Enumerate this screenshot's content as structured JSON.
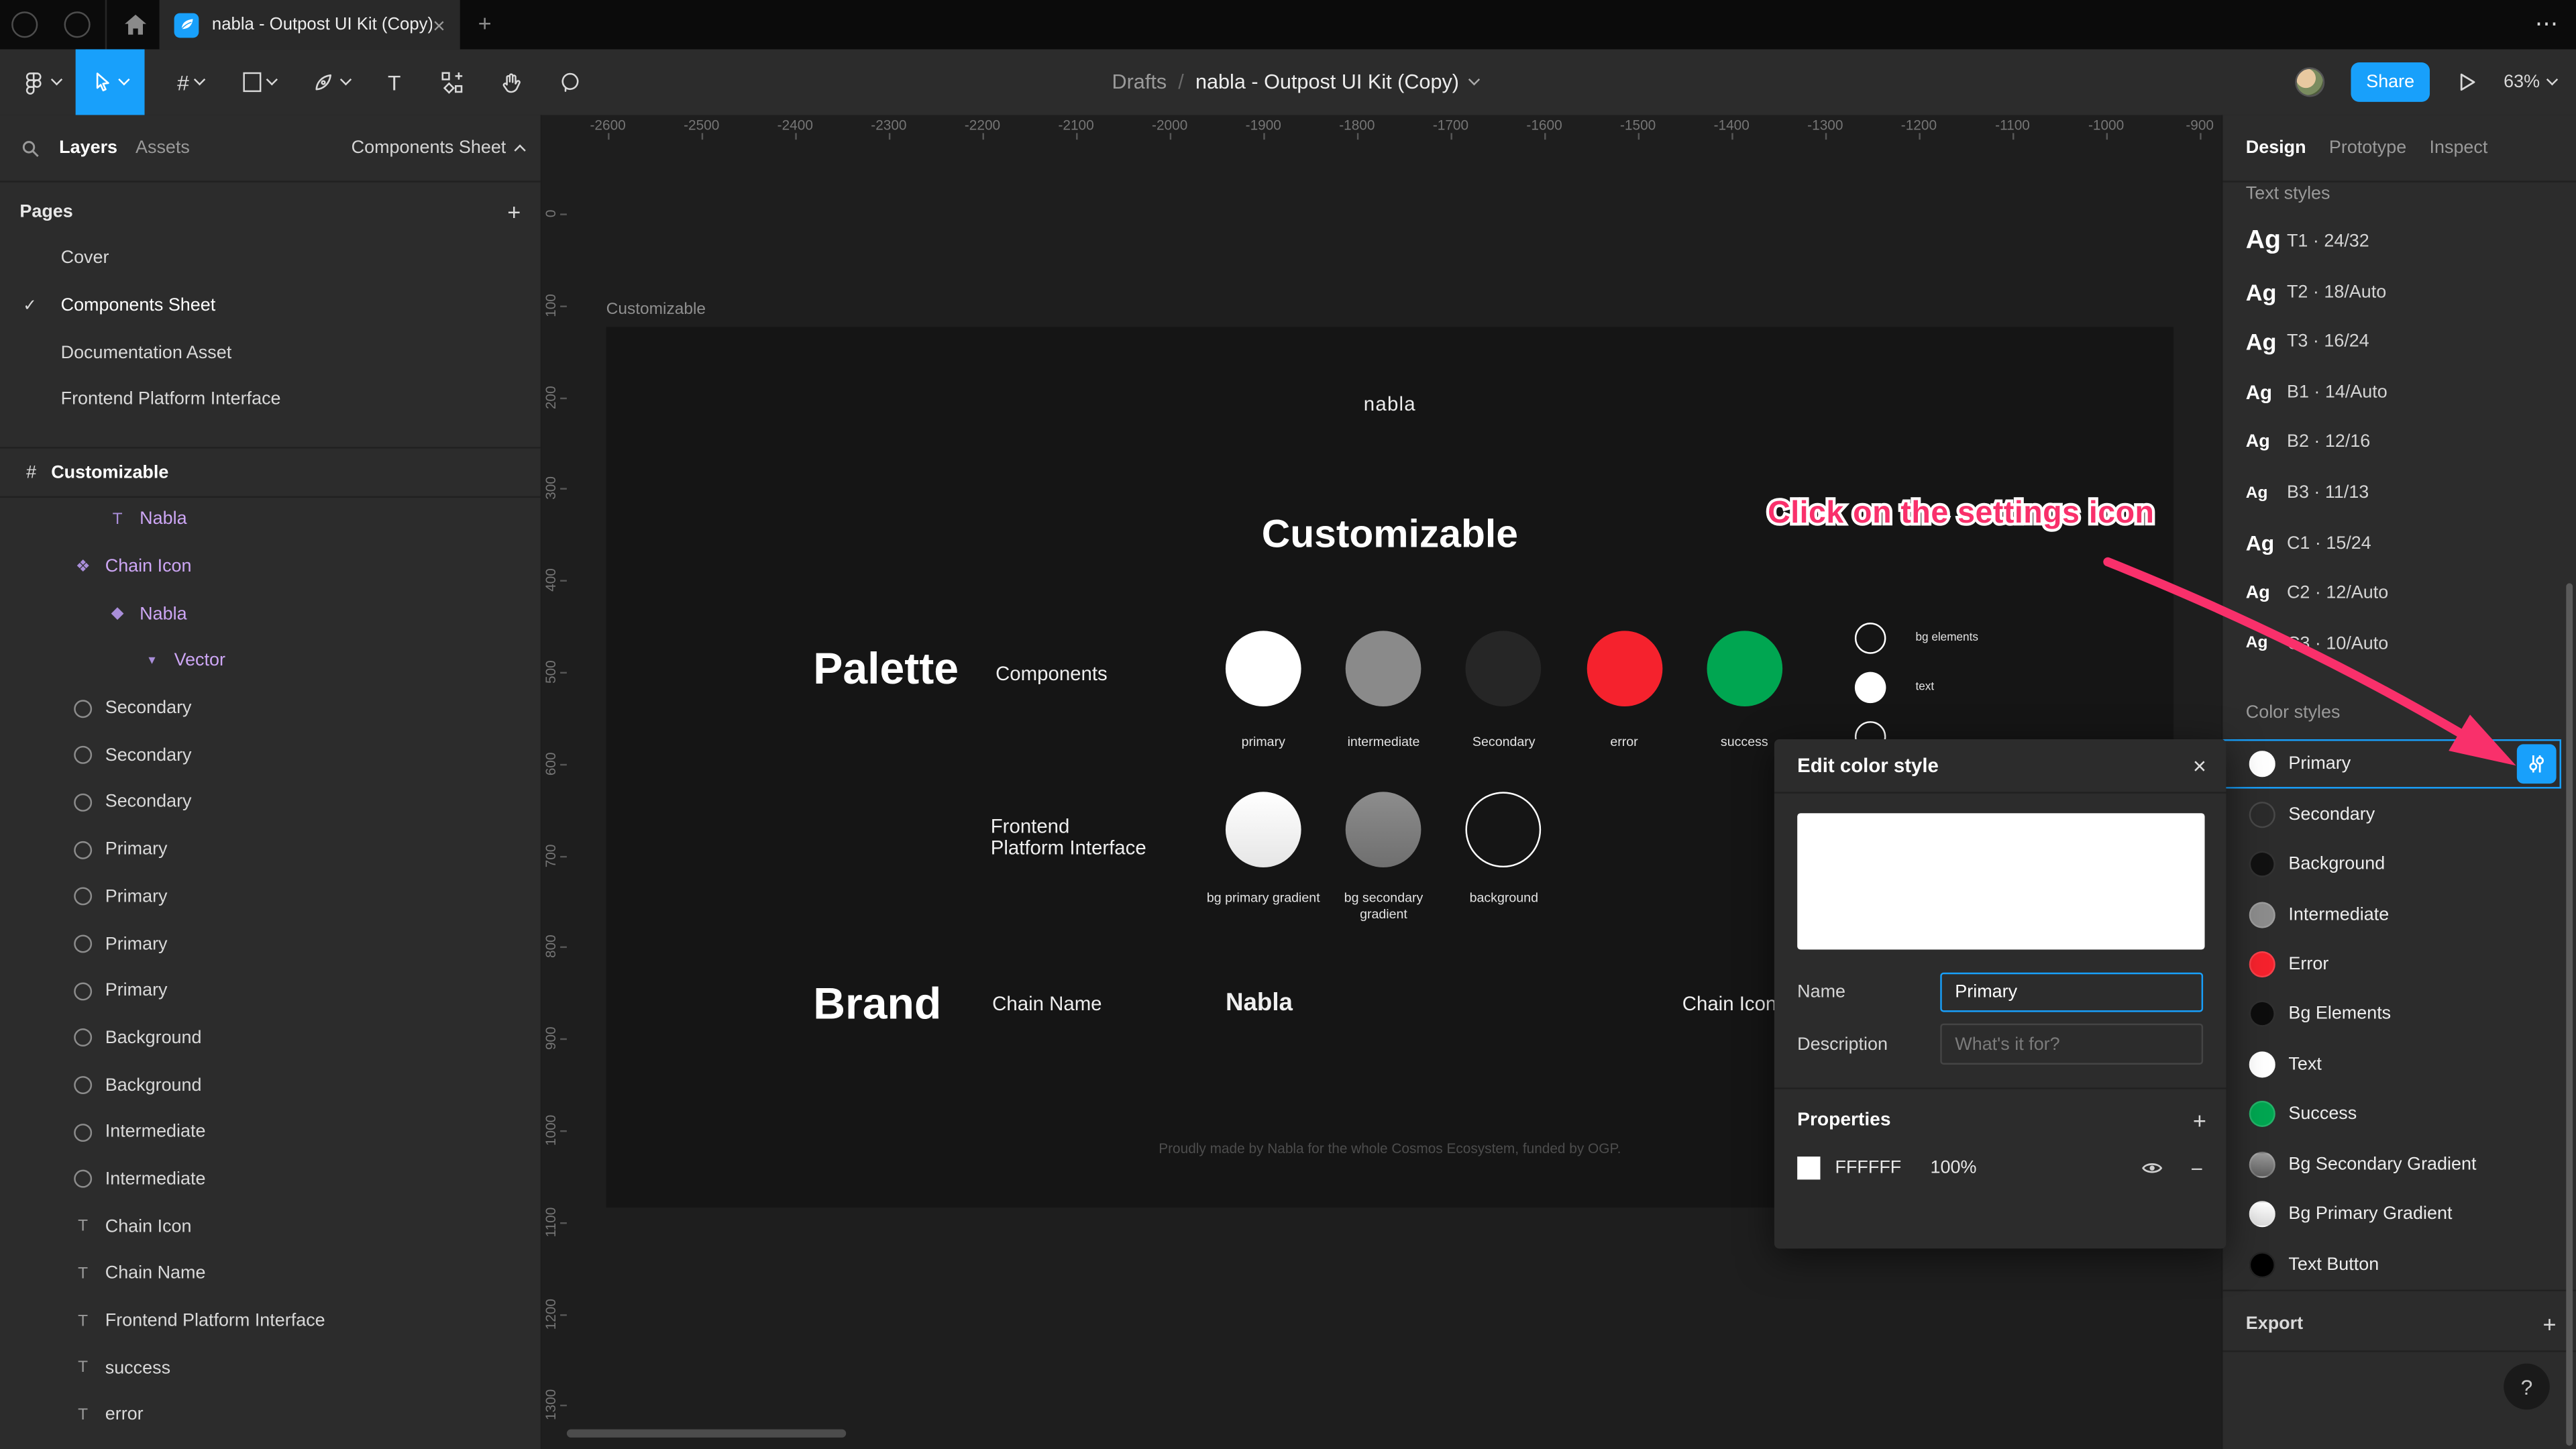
{
  "window": {
    "tab_title": "nabla - Outpost UI Kit (Copy)",
    "close_tab": "×",
    "new_tab": "+",
    "overflow": "⋯"
  },
  "toolbar": {
    "breadcrumb": {
      "root": "Drafts",
      "separator": "/",
      "title": "nabla - Outpost UI Kit (Copy)"
    },
    "share_label": "Share",
    "zoom_level": "63%"
  },
  "left_panel": {
    "tab_layers": "Layers",
    "tab_assets": "Assets",
    "page_selector": "Components Sheet",
    "pages_header": "Pages",
    "add_page": "+",
    "pages": [
      {
        "label": "Cover",
        "checked": ""
      },
      {
        "label": "Components Sheet",
        "checked": "✓"
      },
      {
        "label": "Documentation Asset",
        "checked": ""
      },
      {
        "label": "Frontend Platform Interface",
        "checked": ""
      }
    ],
    "section": {
      "icon": "#",
      "label": "Customizable"
    },
    "layers": [
      {
        "kind": "text",
        "label": "Nabla",
        "purple": true,
        "indent": 2
      },
      {
        "kind": "component",
        "label": "Chain Icon",
        "purple": true,
        "indent": 1
      },
      {
        "kind": "instance",
        "label": "Nabla",
        "purple": true,
        "indent": 2
      },
      {
        "kind": "vector",
        "label": "Vector",
        "purple": true,
        "indent": 3
      },
      {
        "kind": "ellipse",
        "label": "Secondary",
        "purple": false,
        "indent": 1
      },
      {
        "kind": "ellipse",
        "label": "Secondary",
        "purple": false,
        "indent": 1
      },
      {
        "kind": "ellipse",
        "label": "Secondary",
        "purple": false,
        "indent": 1
      },
      {
        "kind": "ellipse",
        "label": "Primary",
        "purple": false,
        "indent": 1
      },
      {
        "kind": "ellipse",
        "label": "Primary",
        "purple": false,
        "indent": 1
      },
      {
        "kind": "ellipse",
        "label": "Primary",
        "purple": false,
        "indent": 1
      },
      {
        "kind": "ellipse",
        "label": "Primary",
        "purple": false,
        "indent": 1
      },
      {
        "kind": "ellipse",
        "label": "Background",
        "purple": false,
        "indent": 1
      },
      {
        "kind": "ellipse",
        "label": "Background",
        "purple": false,
        "indent": 1
      },
      {
        "kind": "ellipse",
        "label": "Intermediate",
        "purple": false,
        "indent": 1
      },
      {
        "kind": "ellipse",
        "label": "Intermediate",
        "purple": false,
        "indent": 1
      },
      {
        "kind": "text",
        "label": "Chain Icon",
        "purple": false,
        "indent": 1
      },
      {
        "kind": "text",
        "label": "Chain Name",
        "purple": false,
        "indent": 1
      },
      {
        "kind": "text",
        "label": "Frontend Platform Interface",
        "purple": false,
        "indent": 1
      },
      {
        "kind": "text",
        "label": "success",
        "purple": false,
        "indent": 1
      },
      {
        "kind": "text",
        "label": "error",
        "purple": false,
        "indent": 1
      }
    ]
  },
  "canvas": {
    "ruler_x": [
      "-2600",
      "-2500",
      "-2400",
      "-2300",
      "-2200",
      "-2100",
      "-2000",
      "-1900",
      "-1800",
      "-1700",
      "-1600",
      "-1500",
      "-1400",
      "-1300",
      "-1200",
      "-1100",
      "-1000",
      "-900"
    ],
    "ruler_y": [
      "0",
      "100",
      "200",
      "300",
      "400",
      "500",
      "600",
      "700",
      "800",
      "900",
      "1000",
      "1100",
      "1200",
      "1300"
    ],
    "frame_label": "Customizable",
    "logo": "nabla",
    "heading": "Customizable",
    "palette": {
      "title": "Palette",
      "subtitle": "Components",
      "swatches": [
        {
          "label": "primary",
          "color": "#ffffff"
        },
        {
          "label": "intermediate",
          "color": "#8a8a8a"
        },
        {
          "label": "Secondary",
          "color": "#262626"
        },
        {
          "label": "error",
          "color": "#f5222d"
        },
        {
          "label": "success",
          "color": "#00a651"
        }
      ],
      "mini": [
        {
          "label": "bg elements",
          "color": "#0d0d0d",
          "outline": true
        },
        {
          "label": "text",
          "color": "#ffffff",
          "outline": false
        },
        {
          "label": "",
          "color": "#0d0d0d",
          "outline": true
        }
      ]
    },
    "fpi": {
      "title": "Frontend Platform Interface",
      "swatches": [
        {
          "label": "bg primary gradient",
          "color": "linear-gradient(180deg,#ffffff,#e6e6e6)",
          "outline": false
        },
        {
          "label": "bg secondary gradient",
          "color": "linear-gradient(180deg,#8d8d8d,#6f6f6f)",
          "outline": false
        },
        {
          "label": "background",
          "color": "#101010",
          "outline": true
        }
      ]
    },
    "brand": {
      "title": "Brand",
      "row_label": "Chain Name",
      "row_value": "Nabla",
      "icon_label": "Chain Icon"
    },
    "footer": "Proudly made by Nabla for the whole Cosmos Ecosystem, funded by OGP."
  },
  "annotation": {
    "text": "Click on the settings icon",
    "color": "#f9306b"
  },
  "dialog": {
    "title": "Edit color style",
    "close": "×",
    "preview_color": "#ffffff",
    "name_label": "Name",
    "name_value": "Primary",
    "description_label": "Description",
    "description_placeholder": "What's it for?",
    "properties_label": "Properties",
    "add": "+",
    "property": {
      "hex": "FFFFFF",
      "opacity": "100%",
      "remove": "−"
    }
  },
  "right_panel": {
    "tab_design": "Design",
    "tab_prototype": "Prototype",
    "tab_inspect": "Inspect",
    "text_styles_header": "Text styles",
    "text_styles": [
      {
        "sample": "Ag",
        "label": "T1 · 24/32",
        "size": 16
      },
      {
        "sample": "Ag",
        "label": "T2 · 18/Auto",
        "size": 14
      },
      {
        "sample": "Ag",
        "label": "T3 · 16/24",
        "size": 14
      },
      {
        "sample": "Ag",
        "label": "B1 · 14/Auto",
        "size": 12
      },
      {
        "sample": "Ag",
        "label": "B2 · 12/16",
        "size": 11
      },
      {
        "sample": "Ag",
        "label": "B3 · 11/13",
        "size": 10
      },
      {
        "sample": "Ag",
        "label": "C1 · 15/24",
        "size": 13
      },
      {
        "sample": "Ag",
        "label": "C2 · 12/Auto",
        "size": 11
      },
      {
        "sample": "Ag",
        "label": "C3 · 10/Auto",
        "size": 10
      }
    ],
    "color_styles_header": "Color styles",
    "color_styles": [
      {
        "label": "Primary",
        "color": "#ffffff",
        "selected": true
      },
      {
        "label": "Secondary",
        "color": "#2b2b2b",
        "selected": false
      },
      {
        "label": "Background",
        "color": "#111111",
        "selected": false
      },
      {
        "label": "Intermediate",
        "color": "#8c8c8c",
        "selected": false
      },
      {
        "label": "Error",
        "color": "#f5222d",
        "selected": false
      },
      {
        "label": "Bg Elements",
        "color": "#0d0d0d",
        "selected": false
      },
      {
        "label": "Text",
        "color": "#ffffff",
        "selected": false
      },
      {
        "label": "Success",
        "color": "#00a651",
        "selected": false
      },
      {
        "label": "Bg Secondary Gradient",
        "color": "linear-gradient(180deg,#9a9a9a,#5f5f5f)",
        "selected": false
      },
      {
        "label": "Bg Primary Gradient",
        "color": "linear-gradient(180deg,#ffffff,#d9d9d9)",
        "selected": false
      },
      {
        "label": "Text Button",
        "color": "#000000",
        "selected": false
      }
    ],
    "export_header": "Export",
    "add_export": "+",
    "help": "?",
    "accent": "#18a0fb"
  }
}
